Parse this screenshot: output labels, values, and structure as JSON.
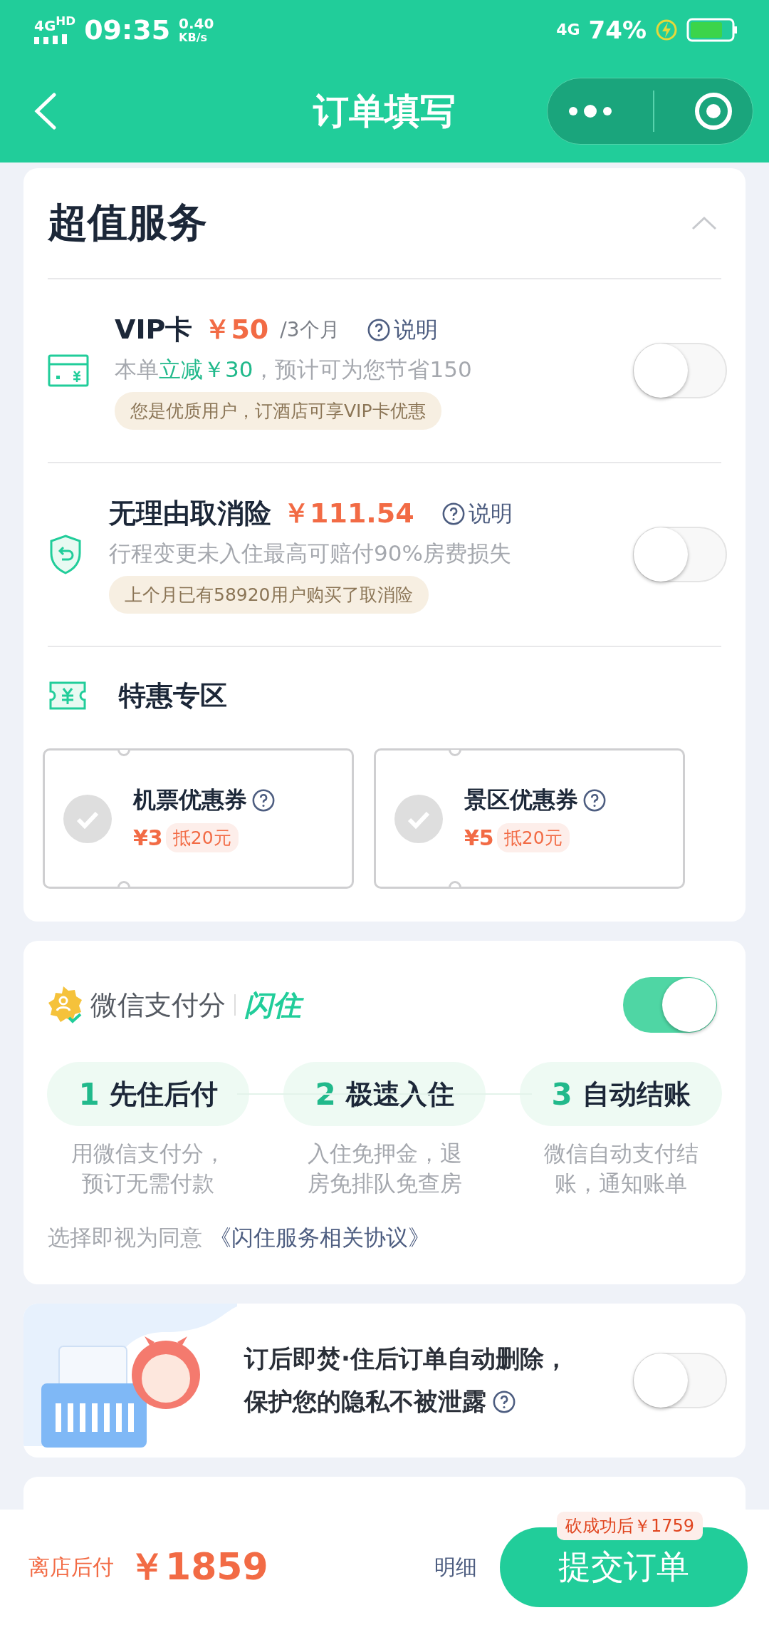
{
  "status_bar": {
    "network": "4G",
    "network_sup": "HD",
    "time": "09:35",
    "speed": "0.40",
    "speed_unit": "KB/s",
    "network_right": "4G",
    "battery": "74%"
  },
  "header": {
    "title": "订单填写"
  },
  "services": {
    "title": "超值服务",
    "expanded": true,
    "items": [
      {
        "kind": "vip",
        "title": "VIP卡",
        "price": "￥50",
        "period": "/3个月",
        "help": "说明",
        "desc_prefix": "本单",
        "desc_highlight": "立减￥30",
        "desc_suffix": "，预计可为您节省150",
        "tag": "您是优质用户，订酒店可享VIP卡优惠",
        "on": false
      },
      {
        "kind": "insurance",
        "title": "无理由取消险",
        "price": "￥111.54",
        "help": "说明",
        "desc_prefix": "行程变更未入住最高可赔付90%房费损失",
        "tag": "上个月已有58920用户购买了取消险",
        "on": false
      }
    ]
  },
  "deals": {
    "title": "特惠专区",
    "coupons": [
      {
        "name": "机票优惠券",
        "price": "¥3",
        "note": "抵20元",
        "selected": false
      },
      {
        "name": "景区优惠券",
        "price": "¥5",
        "note": "抵20元",
        "selected": false
      }
    ]
  },
  "wechat_pay": {
    "brand": "微信支付分",
    "product": "闪住",
    "on": true,
    "steps": [
      {
        "number": "1",
        "title": "先住后付",
        "lines": [
          "用微信支付分，",
          "预订无需付款"
        ]
      },
      {
        "number": "2",
        "title": "极速入住",
        "lines": [
          "入住免押金，退",
          "房免排队免查房"
        ]
      },
      {
        "number": "3",
        "title": "自动结账",
        "lines": [
          "微信自动支付结",
          "账，通知账单"
        ]
      }
    ],
    "agreement_prefix": "选择即视为同意",
    "agreement_link": "《闪住服务相关协议》"
  },
  "privacy": {
    "lines": [
      "订后即焚·住后订单自动删除，",
      "保护您的隐私不被泄露"
    ],
    "on": false
  },
  "footer": {
    "label": "离店后付",
    "price": "￥1859",
    "details": "明细",
    "badge": "砍成功后￥1759",
    "submit": "提交订单"
  }
}
